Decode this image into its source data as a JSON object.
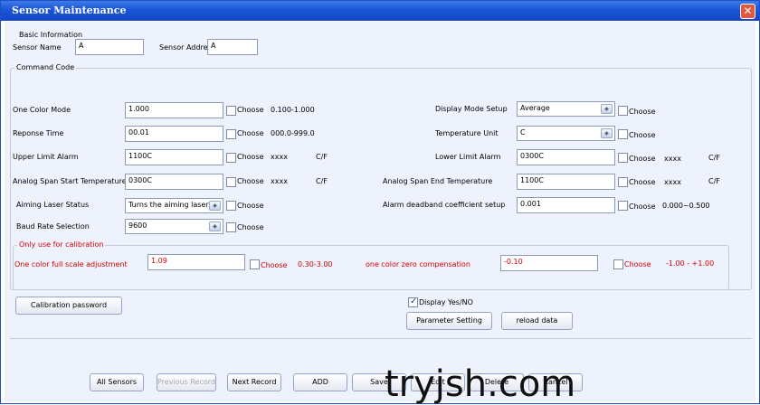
{
  "window": {
    "title": "Sensor Maintenance",
    "close_glyph": "✕"
  },
  "basic": {
    "legend": "Basic Information",
    "sensor_name_label": "Sensor Name",
    "sensor_name_value": "A",
    "sensor_addr_label": "Sensor Addre",
    "sensor_addr_value": "A"
  },
  "command": {
    "legend": "Command Code",
    "choose": "Choose",
    "one_color_mode": {
      "label": "One Color Mode",
      "value": "1.000",
      "range": "0.100-1.000"
    },
    "response_time": {
      "label": "Reponse Time",
      "value": "00.01",
      "range": "000.0-999.0"
    },
    "upper_limit": {
      "label": "Upper Limit Alarm",
      "value": "1100C",
      "range": "xxxx",
      "unit": "C/F"
    },
    "span_start": {
      "label": "Analog Span Start Temperature",
      "value": "0300C",
      "range": "xxxx",
      "unit": "C/F"
    },
    "aiming_laser": {
      "label": "Aiming Laser Status",
      "value": "Turns the aiming laser o"
    },
    "baud_rate": {
      "label": "Baud Rate Selection",
      "value": "9600"
    },
    "display_mode": {
      "label": "Display Mode Setup",
      "value": "Average"
    },
    "temp_unit": {
      "label": "Temperature Unit",
      "value": "C"
    },
    "lower_limit": {
      "label": "Lower Limit Alarm",
      "value": "0300C",
      "range": "xxxx",
      "unit": "C/F"
    },
    "span_end": {
      "label": "Analog Span End Temperature",
      "value": "1100C",
      "range": "xxxx",
      "unit": "C/F"
    },
    "deadband": {
      "label": "Alarm deadband coefficient setup",
      "value": "0.001",
      "range": "0.000~0.500"
    }
  },
  "calibration": {
    "legend": "Only use for calibration",
    "full_scale": {
      "label": "One color full scale adjustment",
      "value": "1.09",
      "range": "0.30-3.00"
    },
    "zero_comp": {
      "label": "one color zero compensation",
      "value": "-0.10",
      "range": "-1.00 - +1.00"
    }
  },
  "actions": {
    "calibration_password": "Calibration password",
    "display_yes_no": "Display Yes/NO",
    "parameter_setting": "Parameter Setting",
    "reload_data": "reload data"
  },
  "bottom_buttons": {
    "all_sensors": "All Sensors",
    "previous_record": "Previous Record",
    "next_record": "Next Record",
    "add": "ADD",
    "save": "Save",
    "edit": "Edit",
    "delete": "Delete",
    "cancel": "Cancel"
  },
  "watermark": "tryjsh.com",
  "colors": {
    "title_bar": "#1b55d9",
    "calibration_text": "#d40000",
    "panel_bg": "#eef2fc"
  }
}
